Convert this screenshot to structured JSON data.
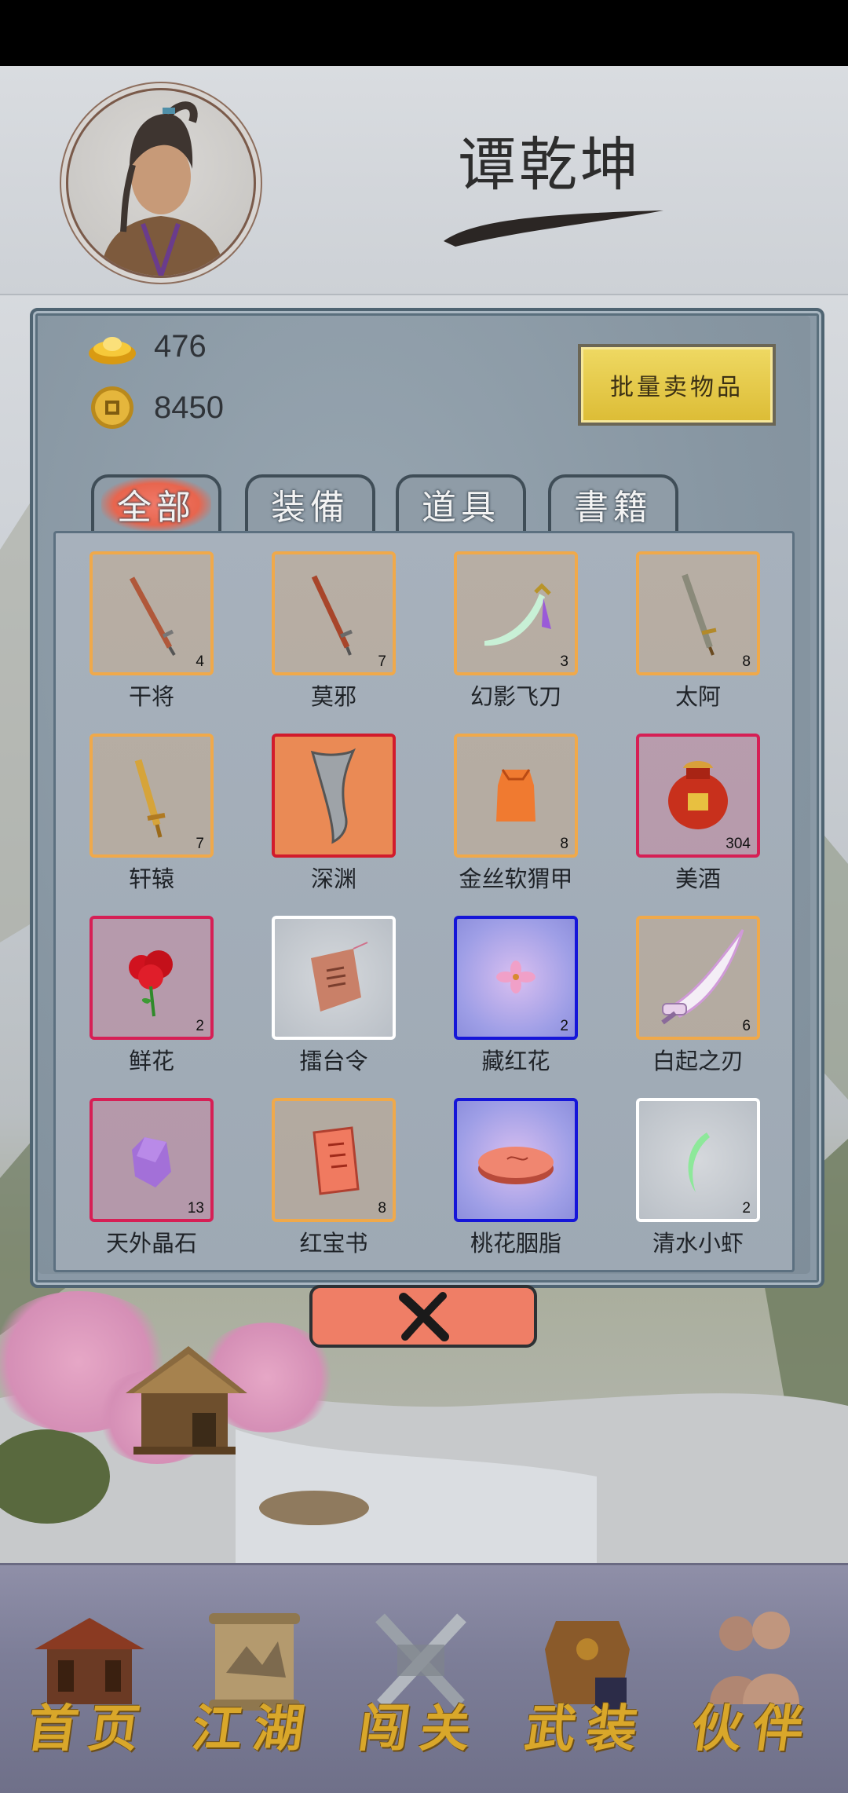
{
  "player": {
    "name": "谭乾坤"
  },
  "currency": {
    "gold": {
      "icon": "gold-ingot-icon",
      "value": "476"
    },
    "coin": {
      "icon": "copper-coin-icon",
      "value": "8450"
    }
  },
  "sell_button_label": "批量卖物品",
  "tabs": [
    {
      "label": "全部",
      "active": true
    },
    {
      "label": "装備",
      "active": false
    },
    {
      "label": "道具",
      "active": false
    },
    {
      "label": "書籍",
      "active": false
    }
  ],
  "items": [
    {
      "name": "干将",
      "count": "4",
      "quality": "orange",
      "icon": "sword-icon"
    },
    {
      "name": "莫邪",
      "count": "7",
      "quality": "orange",
      "icon": "sword-icon"
    },
    {
      "name": "幻影飞刀",
      "count": "3",
      "quality": "orange",
      "icon": "flying-knife-icon"
    },
    {
      "name": "太阿",
      "count": "8",
      "quality": "orange",
      "icon": "sword-icon"
    },
    {
      "name": "轩辕",
      "count": "7",
      "quality": "orange",
      "icon": "golden-sword-icon"
    },
    {
      "name": "深渊",
      "count": "",
      "quality": "orange-fill",
      "icon": "broad-blade-icon"
    },
    {
      "name": "金丝软猬甲",
      "count": "8",
      "quality": "orange",
      "icon": "armor-vest-icon"
    },
    {
      "name": "美酒",
      "count": "304",
      "quality": "red",
      "icon": "wine-jar-icon"
    },
    {
      "name": "鲜花",
      "count": "2",
      "quality": "red",
      "icon": "rose-icon"
    },
    {
      "name": "擂台令",
      "count": "",
      "quality": "white",
      "icon": "token-icon"
    },
    {
      "name": "藏红花",
      "count": "2",
      "quality": "blue",
      "icon": "saffron-flower-icon"
    },
    {
      "name": "白起之刃",
      "count": "6",
      "quality": "orange",
      "icon": "sabre-icon"
    },
    {
      "name": "天外晶石",
      "count": "13",
      "quality": "red",
      "icon": "crystal-icon"
    },
    {
      "name": "红宝书",
      "count": "8",
      "quality": "orange",
      "icon": "red-book-icon"
    },
    {
      "name": "桃花胭脂",
      "count": "",
      "quality": "blue",
      "icon": "rouge-box-icon"
    },
    {
      "name": "清水小虾",
      "count": "2",
      "quality": "white",
      "icon": "shrimp-icon"
    }
  ],
  "nav": [
    {
      "label": "首页",
      "icon": "home-pavilion-icon"
    },
    {
      "label": "江湖",
      "icon": "scroll-map-icon"
    },
    {
      "label": "闯关",
      "icon": "crossed-swords-icon"
    },
    {
      "label": "武装",
      "icon": "armor-icon"
    },
    {
      "label": "伙伴",
      "icon": "companions-icon"
    }
  ]
}
